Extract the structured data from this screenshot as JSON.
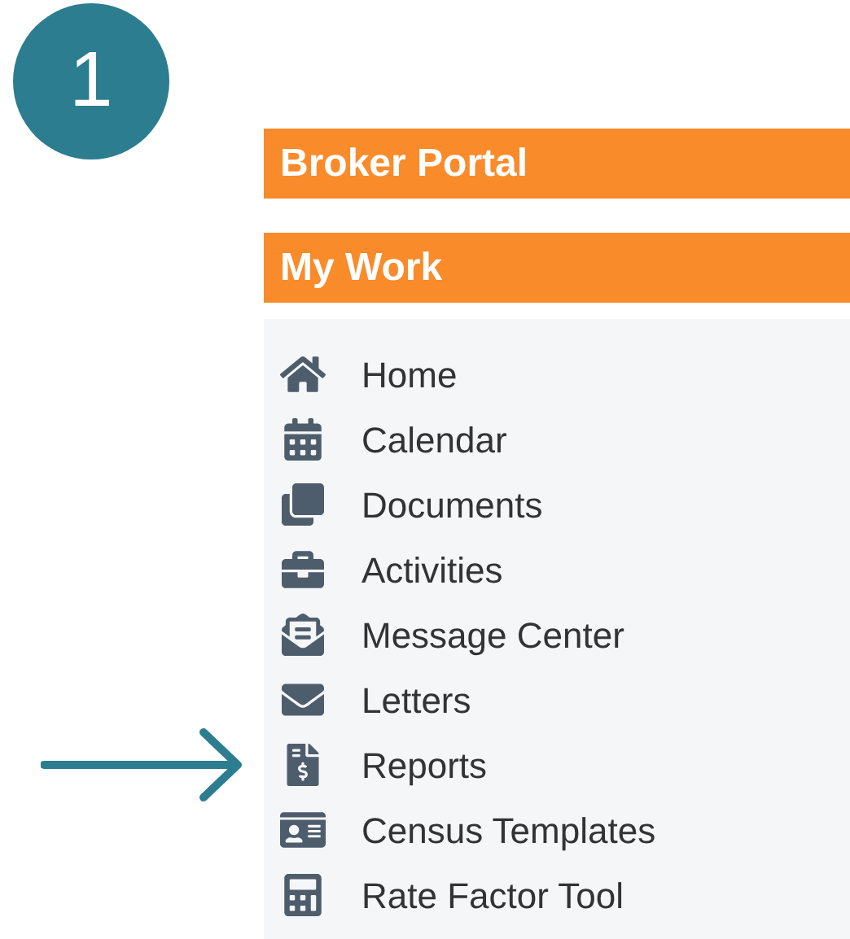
{
  "step_badge": "1",
  "header": {
    "title": "Broker Portal"
  },
  "section": {
    "title": "My Work"
  },
  "menu": [
    {
      "label": "Home",
      "kind": "home"
    },
    {
      "label": "Calendar",
      "kind": "calendar"
    },
    {
      "label": "Documents",
      "kind": "documents"
    },
    {
      "label": "Activities",
      "kind": "activities"
    },
    {
      "label": "Message Center",
      "kind": "messages"
    },
    {
      "label": "Letters",
      "kind": "letters"
    },
    {
      "label": "Reports",
      "kind": "reports",
      "pointed": true
    },
    {
      "label": "Census Templates",
      "kind": "census"
    },
    {
      "label": "Rate Factor Tool",
      "kind": "calculator"
    }
  ]
}
